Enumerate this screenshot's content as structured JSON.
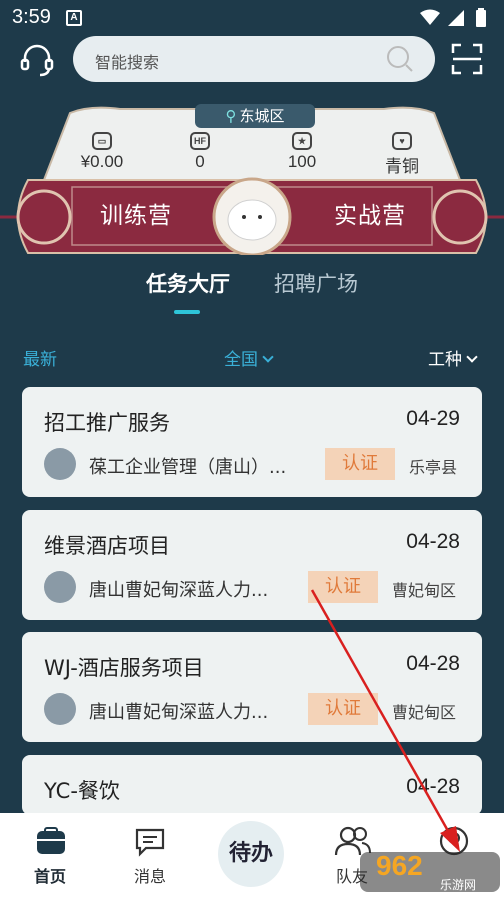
{
  "status_bar": {
    "time": "3:59",
    "notif_letter": "A"
  },
  "search": {
    "placeholder": "智能搜索"
  },
  "banner": {
    "location": "东城区",
    "stats": [
      {
        "icon": "wallet-icon",
        "value": "¥0.00"
      },
      {
        "icon": "hf-icon",
        "icon_text": "HF",
        "value": "0"
      },
      {
        "icon": "star-icon",
        "value": "100"
      },
      {
        "icon": "heart-icon",
        "value": "青铜"
      }
    ],
    "left_camp": "训练营",
    "right_camp": "实战营"
  },
  "tabs": {
    "active": "任务大厅",
    "inactive": "招聘广场"
  },
  "filters": {
    "latest": "最新",
    "region": "全国",
    "trade": "工种"
  },
  "cards": [
    {
      "title": "招工推广服务",
      "date": "04-29",
      "company": "葆工企业管理（唐山）...",
      "badge": "认证",
      "area": "乐亭县"
    },
    {
      "title": "维景酒店项目",
      "date": "04-28",
      "company": "唐山曹妃甸深蓝人力...",
      "badge": "认证",
      "area": "曹妃甸区"
    },
    {
      "title": "WJ-酒店服务项目",
      "date": "04-28",
      "company": "唐山曹妃甸深蓝人力...",
      "badge": "认证",
      "area": "曹妃甸区"
    },
    {
      "title": "YC-餐饮",
      "date": "04-28"
    }
  ],
  "bottom_nav": {
    "home": "首页",
    "messages": "消息",
    "todo": "待办",
    "team": "队友"
  },
  "watermark": {
    "text": "962",
    "sub": "乐游网"
  },
  "colors": {
    "background": "#1e3a4a",
    "accent": "#2ec5d9",
    "badge": "#e07a3a",
    "banner": "#8b2a40"
  }
}
